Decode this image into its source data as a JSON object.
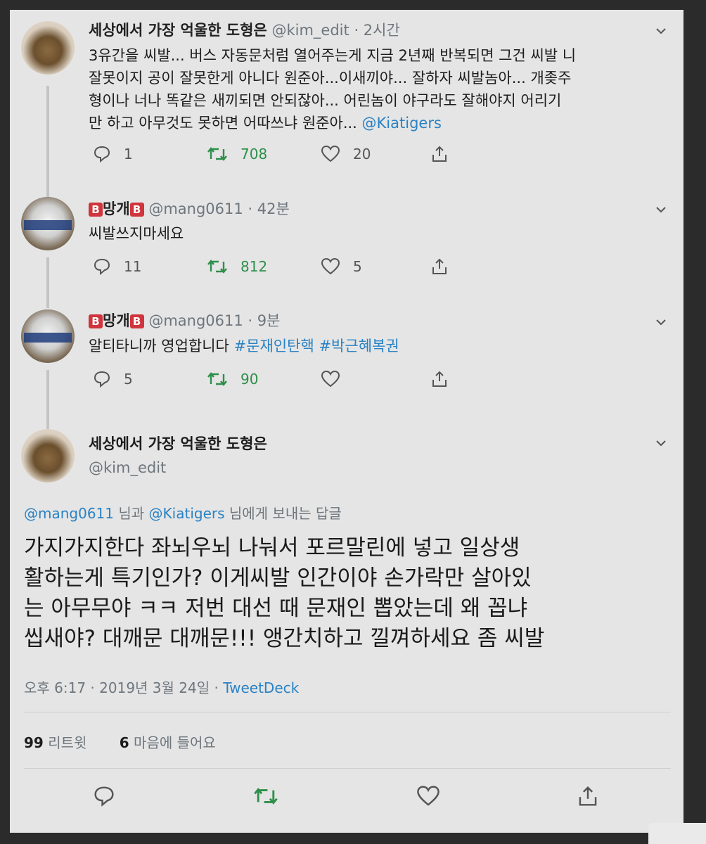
{
  "tweets": [
    {
      "name": "세상에서 가장 억울한 도형은",
      "handle": "@kim_edit",
      "time": "· 2시간",
      "lines": [
        "3유간을 씨발... 버스 자동문처럼 열어주는게 지금 2년째 반복되면 그건 씨발 니",
        "잘못이지 공이 잘못한게 아니다 원준아...이새끼야... 잘하자 씨발놈아... 개좆주",
        "형이나 너나 똑같은 새끼되면 안되잖아... 어린놈이 야구라도 잘해야지 어리기"
      ],
      "last_line": "만 하고 아무것도 못하면 어따쓰냐 원준아...",
      "mention": "@Kiatigers",
      "replies": "1",
      "retweets": "708",
      "likes": "20"
    },
    {
      "badge": "B",
      "name": "망개",
      "handle": "@mang0611",
      "time": "· 42분",
      "text": "씨발쓰지마세요",
      "replies": "11",
      "retweets": "812",
      "likes": "5"
    },
    {
      "badge": "B",
      "name": "망개",
      "handle": "@mang0611",
      "time": "· 9분",
      "text": "알티타니까 영업합니다",
      "hashtag1": "#문재인탄핵",
      "hashtag2": "#박근혜복권",
      "replies": "5",
      "retweets": "90",
      "likes": ""
    }
  ],
  "main": {
    "name": "세상에서 가장 억울한 도형은",
    "handle": "@kim_edit",
    "reply_mention1": "@mang0611",
    "reply_mid": "님과",
    "reply_mention2": "@Kiatigers",
    "reply_tail": "님에게 보내는 답글",
    "lines": [
      "가지가지한다 좌뇌우뇌 나눠서 포르말린에 넣고 일상생",
      "활하는게 특기인가? 이게씨발 인간이야 손가락만 살아있",
      "는 아무무야 ㅋㅋ 저번 대선 때 문재인 뽑았는데 왜 꼽냐",
      "씹새야? 대깨문 대깨문!!! 앵간치하고 낄껴하세요 좀 씨발"
    ],
    "timestamp": "오후 6:17 · 2019년 3월 24일 ·",
    "client": "TweetDeck",
    "retweet_count": "99",
    "retweet_label": "리트윗",
    "like_count": "6",
    "like_label": "마음에 들어요"
  },
  "colors": {
    "link": "#2a82c4",
    "retweet": "#2e8f4a",
    "badge": "#d0343c"
  }
}
